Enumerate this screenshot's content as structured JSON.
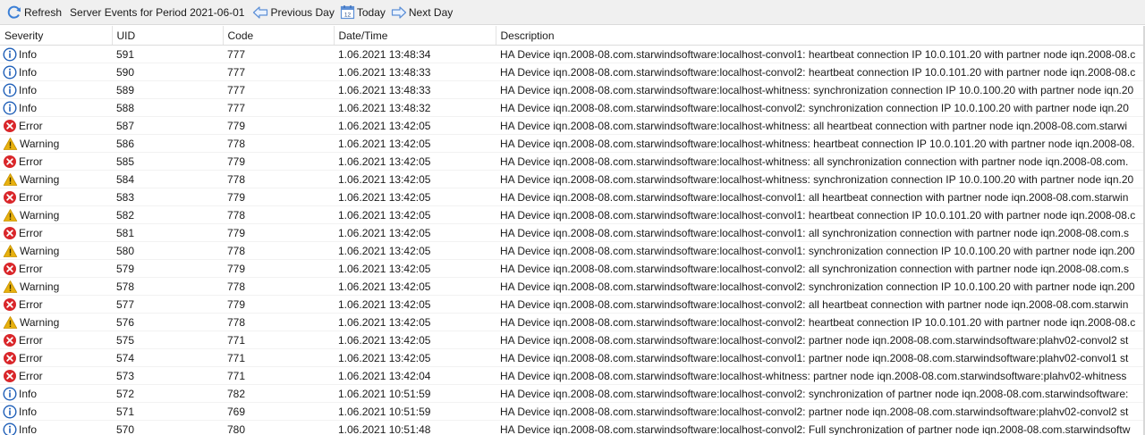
{
  "toolbar": {
    "refresh_label": "Refresh",
    "title": "Server Events for Period 2021-06-01",
    "prev_label": "Previous Day",
    "today_label": "Today",
    "today_icon_text": "12",
    "next_label": "Next Day",
    "refresh_icon": "refresh-icon",
    "prev_icon": "arrow-left-icon",
    "today_icon": "calendar-icon",
    "next_icon": "arrow-right-icon"
  },
  "columns": [
    "Severity",
    "UID",
    "Code",
    "Date/Time",
    "Description"
  ],
  "colors": {
    "info": "#1f5fb8",
    "error": "#d9262a",
    "warning": "#e8b10e"
  },
  "rows": [
    {
      "severity": "Info",
      "uid": "591",
      "code": "777",
      "datetime": "1.06.2021 13:48:34",
      "description": "HA Device iqn.2008-08.com.starwindsoftware:localhost-convol1: heartbeat connection IP 10.0.101.20 with partner node iqn.2008-08.c"
    },
    {
      "severity": "Info",
      "uid": "590",
      "code": "777",
      "datetime": "1.06.2021 13:48:33",
      "description": "HA Device iqn.2008-08.com.starwindsoftware:localhost-convol2: heartbeat connection IP 10.0.101.20 with partner node iqn.2008-08.c"
    },
    {
      "severity": "Info",
      "uid": "589",
      "code": "777",
      "datetime": "1.06.2021 13:48:33",
      "description": "HA Device iqn.2008-08.com.starwindsoftware:localhost-whitness: synchronization connection IP 10.0.100.20 with partner node iqn.20"
    },
    {
      "severity": "Info",
      "uid": "588",
      "code": "777",
      "datetime": "1.06.2021 13:48:32",
      "description": "HA Device iqn.2008-08.com.starwindsoftware:localhost-convol2: synchronization connection IP 10.0.100.20 with partner node iqn.20"
    },
    {
      "severity": "Error",
      "uid": "587",
      "code": "779",
      "datetime": "1.06.2021 13:42:05",
      "description": "HA Device iqn.2008-08.com.starwindsoftware:localhost-whitness: all heartbeat connection with partner node iqn.2008-08.com.starwi"
    },
    {
      "severity": "Warning",
      "uid": "586",
      "code": "778",
      "datetime": "1.06.2021 13:42:05",
      "description": "HA Device iqn.2008-08.com.starwindsoftware:localhost-whitness: heartbeat connection IP 10.0.101.20 with partner node iqn.2008-08."
    },
    {
      "severity": "Error",
      "uid": "585",
      "code": "779",
      "datetime": "1.06.2021 13:42:05",
      "description": "HA Device iqn.2008-08.com.starwindsoftware:localhost-whitness: all synchronization connection with partner node iqn.2008-08.com."
    },
    {
      "severity": "Warning",
      "uid": "584",
      "code": "778",
      "datetime": "1.06.2021 13:42:05",
      "description": "HA Device iqn.2008-08.com.starwindsoftware:localhost-whitness: synchronization connection IP 10.0.100.20 with partner node iqn.20"
    },
    {
      "severity": "Error",
      "uid": "583",
      "code": "779",
      "datetime": "1.06.2021 13:42:05",
      "description": "HA Device iqn.2008-08.com.starwindsoftware:localhost-convol1: all heartbeat connection with partner node iqn.2008-08.com.starwin"
    },
    {
      "severity": "Warning",
      "uid": "582",
      "code": "778",
      "datetime": "1.06.2021 13:42:05",
      "description": "HA Device iqn.2008-08.com.starwindsoftware:localhost-convol1: heartbeat connection IP 10.0.101.20 with partner node iqn.2008-08.c"
    },
    {
      "severity": "Error",
      "uid": "581",
      "code": "779",
      "datetime": "1.06.2021 13:42:05",
      "description": "HA Device iqn.2008-08.com.starwindsoftware:localhost-convol1: all synchronization connection with partner node iqn.2008-08.com.s"
    },
    {
      "severity": "Warning",
      "uid": "580",
      "code": "778",
      "datetime": "1.06.2021 13:42:05",
      "description": "HA Device iqn.2008-08.com.starwindsoftware:localhost-convol1: synchronization connection IP 10.0.100.20 with partner node iqn.200"
    },
    {
      "severity": "Error",
      "uid": "579",
      "code": "779",
      "datetime": "1.06.2021 13:42:05",
      "description": "HA Device iqn.2008-08.com.starwindsoftware:localhost-convol2: all synchronization connection with partner node iqn.2008-08.com.s"
    },
    {
      "severity": "Warning",
      "uid": "578",
      "code": "778",
      "datetime": "1.06.2021 13:42:05",
      "description": "HA Device iqn.2008-08.com.starwindsoftware:localhost-convol2: synchronization connection IP 10.0.100.20 with partner node iqn.200"
    },
    {
      "severity": "Error",
      "uid": "577",
      "code": "779",
      "datetime": "1.06.2021 13:42:05",
      "description": "HA Device iqn.2008-08.com.starwindsoftware:localhost-convol2: all heartbeat connection with partner node iqn.2008-08.com.starwin"
    },
    {
      "severity": "Warning",
      "uid": "576",
      "code": "778",
      "datetime": "1.06.2021 13:42:05",
      "description": "HA Device iqn.2008-08.com.starwindsoftware:localhost-convol2: heartbeat connection IP 10.0.101.20 with partner node iqn.2008-08.c"
    },
    {
      "severity": "Error",
      "uid": "575",
      "code": "771",
      "datetime": "1.06.2021 13:42:05",
      "description": "HA Device iqn.2008-08.com.starwindsoftware:localhost-convol2: partner node iqn.2008-08.com.starwindsoftware:plahv02-convol2 st"
    },
    {
      "severity": "Error",
      "uid": "574",
      "code": "771",
      "datetime": "1.06.2021 13:42:05",
      "description": "HA Device iqn.2008-08.com.starwindsoftware:localhost-convol1: partner node iqn.2008-08.com.starwindsoftware:plahv02-convol1 st"
    },
    {
      "severity": "Error",
      "uid": "573",
      "code": "771",
      "datetime": "1.06.2021 13:42:04",
      "description": "HA Device iqn.2008-08.com.starwindsoftware:localhost-whitness: partner node iqn.2008-08.com.starwindsoftware:plahv02-whitness"
    },
    {
      "severity": "Info",
      "uid": "572",
      "code": "782",
      "datetime": "1.06.2021 10:51:59",
      "description": "HA Device iqn.2008-08.com.starwindsoftware:localhost-convol2: synchronization of partner node iqn.2008-08.com.starwindsoftware:"
    },
    {
      "severity": "Info",
      "uid": "571",
      "code": "769",
      "datetime": "1.06.2021 10:51:59",
      "description": "HA Device iqn.2008-08.com.starwindsoftware:localhost-convol2: partner node iqn.2008-08.com.starwindsoftware:plahv02-convol2 st"
    },
    {
      "severity": "Info",
      "uid": "570",
      "code": "780",
      "datetime": "1.06.2021 10:51:48",
      "description": "HA Device iqn.2008-08.com.starwindsoftware:localhost-convol2: Full synchronization of partner node iqn.2008-08.com.starwindsoftw"
    }
  ]
}
